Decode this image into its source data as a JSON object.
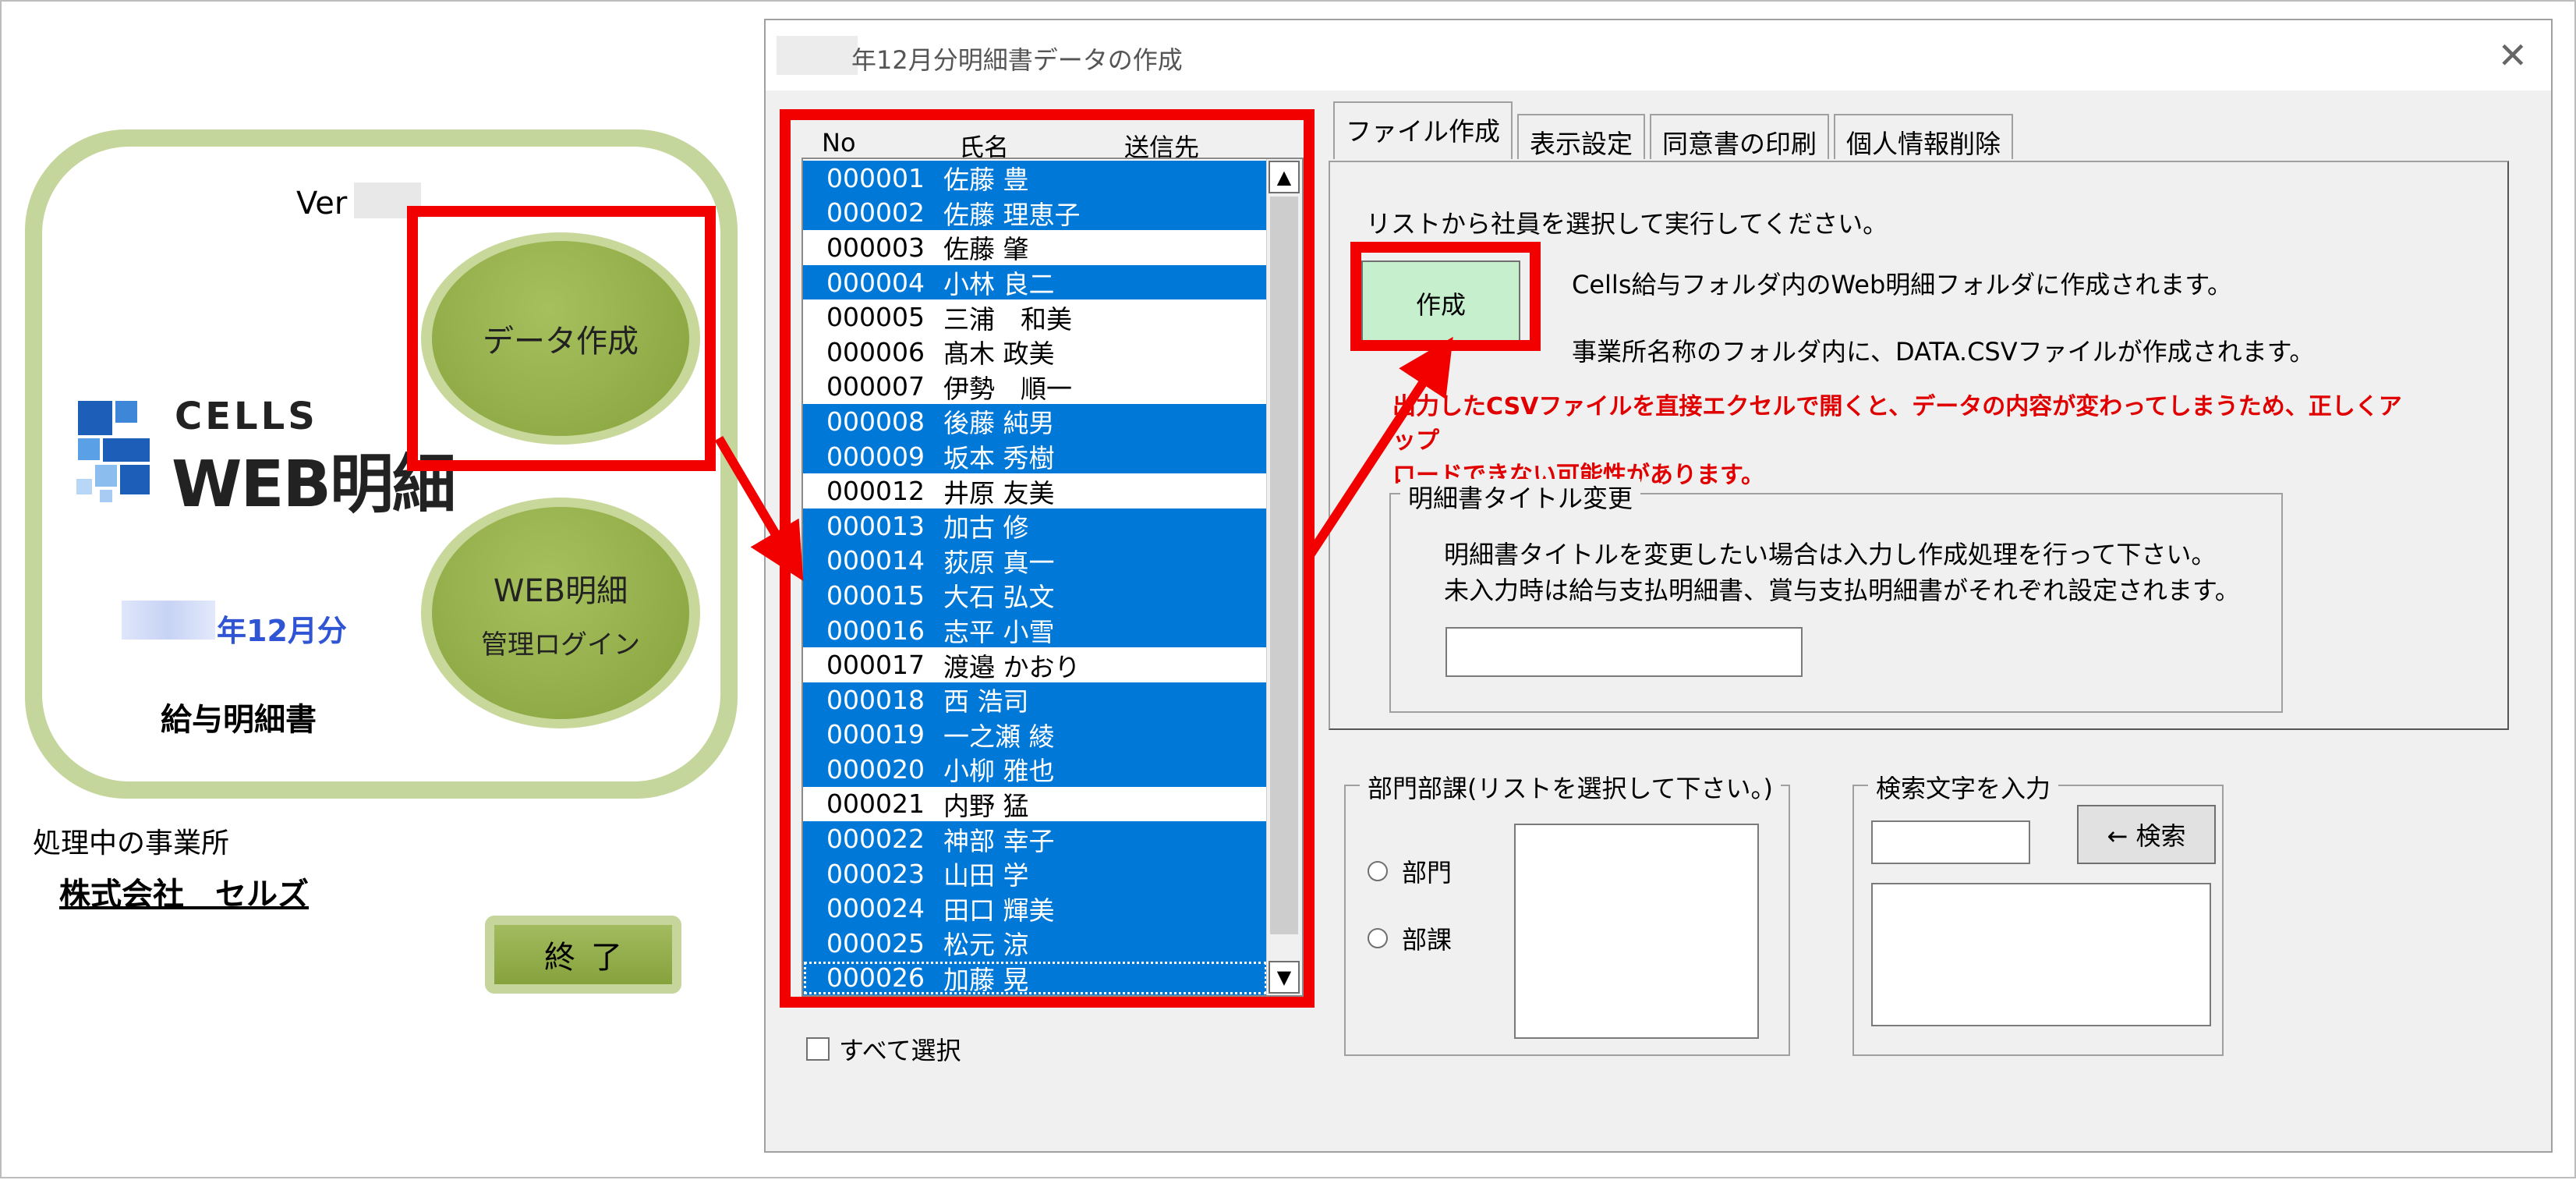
{
  "left_panel": {
    "version_label": "Ver",
    "logo_cells": "CELLS",
    "logo_web": "WEB明細",
    "data_button": "データ作成",
    "web_button_line1": "WEB明細",
    "web_button_line2": "管理ログイン",
    "month_label": "年12月分",
    "kyuyo_label": "給与明細書",
    "office_label": "処理中の事業所",
    "office_name": "株式会社　セルズ",
    "end_button": "終了"
  },
  "dialog": {
    "title": "年12月分明細書データの作成",
    "close_icon": "close-icon",
    "list": {
      "headers": {
        "no": "No",
        "name": "氏名",
        "dest": "送信先"
      },
      "rows": [
        {
          "no": "000001",
          "name": "佐藤 豊",
          "selected": true
        },
        {
          "no": "000002",
          "name": "佐藤 理恵子",
          "selected": true
        },
        {
          "no": "000003",
          "name": "佐藤 肇",
          "selected": false
        },
        {
          "no": "000004",
          "name": "小林 良二",
          "selected": true
        },
        {
          "no": "000005",
          "name": "三浦　和美",
          "selected": false
        },
        {
          "no": "000006",
          "name": "髙木 政美",
          "selected": false
        },
        {
          "no": "000007",
          "name": "伊勢　順一",
          "selected": false
        },
        {
          "no": "000008",
          "name": "後藤 純男",
          "selected": true
        },
        {
          "no": "000009",
          "name": "坂本 秀樹",
          "selected": true
        },
        {
          "no": "000012",
          "name": "井原 友美",
          "selected": false
        },
        {
          "no": "000013",
          "name": "加古 修",
          "selected": true
        },
        {
          "no": "000014",
          "name": "荻原 真一",
          "selected": true
        },
        {
          "no": "000015",
          "name": "大石 弘文",
          "selected": true
        },
        {
          "no": "000016",
          "name": "志平 小雪",
          "selected": true
        },
        {
          "no": "000017",
          "name": "渡邉 かおり",
          "selected": false
        },
        {
          "no": "000018",
          "name": "西 浩司",
          "selected": true
        },
        {
          "no": "000019",
          "name": "一之瀬 綾",
          "selected": true
        },
        {
          "no": "000020",
          "name": "小柳 雅也",
          "selected": true
        },
        {
          "no": "000021",
          "name": "内野 猛",
          "selected": false
        },
        {
          "no": "000022",
          "name": "神部 幸子",
          "selected": true
        },
        {
          "no": "000023",
          "name": "山田 学",
          "selected": true
        },
        {
          "no": "000024",
          "name": "田口 輝美",
          "selected": true
        },
        {
          "no": "000025",
          "name": "松元 涼",
          "selected": true
        },
        {
          "no": "000026",
          "name": "加藤 晃",
          "selected": true
        }
      ]
    },
    "select_all_label": "すべて選択",
    "tabs": [
      "ファイル作成",
      "表示設定",
      "同意書の印刷",
      "個人情報削除"
    ],
    "instruction": "リストから社員を選択して実行してください。",
    "make_button": "作成",
    "info1": "Cells給与フォルダ内のWeb明細フォルダに作成されます。",
    "info2": "事業所名称のフォルダ内に、DATA.CSVファイルが作成されます。",
    "warning_line1": "出力したCSVファイルを直接エクセルで開くと、データの内容が変わってしまうため、正しくアップ",
    "warning_line2": "ロードできない可能性があります。",
    "title_group": {
      "label": "明細書タイトル変更",
      "text1": "明細書タイトルを変更したい場合は入力し作成処理を行って下さい。",
      "text2": "未入力時は給与支払明細書、賞与支払明細書がそれぞれ設定されます。",
      "input_value": ""
    },
    "dept_group": {
      "label": "部門部課(リストを選択して下さい。)",
      "radio1": "部門",
      "radio2": "部課"
    },
    "search_group": {
      "label": "検索文字を入力",
      "input_value": "",
      "button": "← 検索"
    }
  },
  "colors": {
    "selection": "#0078d7",
    "highlight": "#f20000",
    "make_button": "#c6efce",
    "warning": "#e00000"
  }
}
